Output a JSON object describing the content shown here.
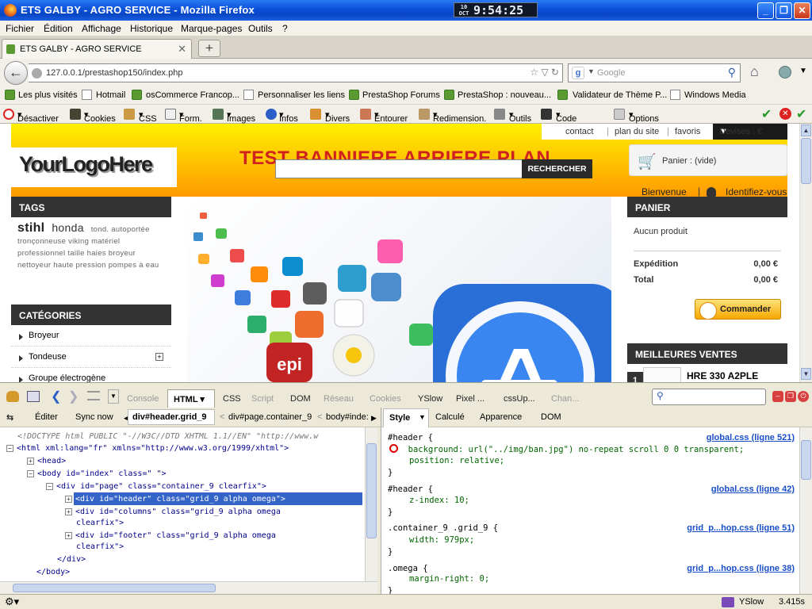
{
  "window": {
    "title": "ETS GALBY - AGRO SERVICE - Mozilla Firefox"
  },
  "clock": {
    "day": "10",
    "month": "OCT",
    "time": "9:54:25"
  },
  "menu": [
    "Fichier",
    "Édition",
    "Affichage",
    "Historique",
    "Marque-pages",
    "Outils",
    "?"
  ],
  "tabs": [
    {
      "label": "ETS GALBY - AGRO SERVICE"
    }
  ],
  "nav": {
    "url": "127.0.0.1/prestashop150/index.php",
    "search_placeholder": "Google"
  },
  "bookmarks": [
    "Les plus visités",
    "Hotmail",
    "osCommerce Francop...",
    "Personnaliser les liens",
    "PrestaShop Forums",
    "PrestaShop : nouveau...",
    "Validateur de Thème P...",
    "Windows Media"
  ],
  "webdev": [
    "Désactiver",
    "Cookies",
    "CSS",
    "Form.",
    "Images",
    "Infos",
    "Divers",
    "Entourer",
    "Redimension.",
    "Outils",
    "Code source",
    "Options"
  ],
  "site": {
    "toplinks": [
      "contact",
      "plan du site",
      "favoris"
    ],
    "devises": "Devises : €",
    "logo": "YourLogoHere",
    "banner_text": "TEST BANNIERE ARRIERE PLAN",
    "search_button": "RECHERCHER",
    "cart_label": "Panier : (vide)",
    "welcome": "Bienvenue",
    "login": "Identifiez-vous",
    "tags_title": "TAGS",
    "tags_big": [
      "stihl",
      "honda"
    ],
    "tags_small": "tond. autoportée tronçonneuse viking matériel professionnel taille haies broyeur nettoyeur haute pression pompes à eau",
    "categories_title": "CATÉGORIES",
    "categories": [
      "Broyeur",
      "Tondeuse",
      "Groupe électrogène"
    ],
    "panier_title": "PANIER",
    "panier_empty": "Aucun produit",
    "shipping_label": "Expédition",
    "shipping_value": "0,00 €",
    "total_label": "Total",
    "total_value": "0,00 €",
    "order_button": "Commander",
    "bestsellers_title": "MEILLEURES VENTES",
    "best_item_rank": "1",
    "best_item_name": "HRE 330 A2PLE",
    "slide_label": "epi"
  },
  "firebug": {
    "tabs": [
      "Console",
      "HTML",
      "CSS",
      "Script",
      "DOM",
      "Réseau",
      "Cookies",
      "YSlow",
      "Pixel ...",
      "cssUp...",
      "Chan..."
    ],
    "left_toolbar": {
      "edit": "Éditer",
      "sync": "Sync now",
      "crumbs": [
        "div#header.grid_9",
        "div#page.container_9",
        "body#inde:"
      ]
    },
    "right_tabs": [
      "Style",
      "Calculé",
      "Apparence",
      "DOM"
    ],
    "tree": [
      "<!DOCTYPE html PUBLIC \"-//W3C//DTD XHTML 1.1//EN\" \"http://www.w",
      "<html xml:lang=\"fr\" xmlns=\"http://www.w3.org/1999/xhtml\">",
      "<head>",
      "<body id=\"index\" class=\" \">",
      "<div id=\"page\" class=\"container_9 clearfix\">",
      "<div id=\"header\" class=\"grid_9 alpha omega\">",
      "<div id=\"columns\" class=\"grid_9 alpha omega",
      "clearfix\">",
      "<div id=\"footer\" class=\"grid_9 alpha omega",
      "clearfix\">",
      "</div>",
      "</body>"
    ],
    "styles": [
      {
        "selector": "#header {",
        "src": "global.css (ligne 521)",
        "props": [
          "background: url(\"../img/ban.jpg\") no-repeat scroll 0 0 transparent;",
          "position: relative;"
        ]
      },
      {
        "selector": "#header {",
        "src": "global.css (ligne 42)",
        "props": [
          "z-index: 10;"
        ]
      },
      {
        "selector": ".container_9 .grid_9 {",
        "src": "grid_p...hop.css (ligne 51)",
        "props": [
          "width: 979px;"
        ]
      },
      {
        "selector": ".omega {",
        "src": "grid_p...hop.css (ligne 38)",
        "props": [
          "margin-right: 0;"
        ]
      }
    ]
  },
  "status": {
    "yslow": "YSlow",
    "time": "3.415s"
  }
}
